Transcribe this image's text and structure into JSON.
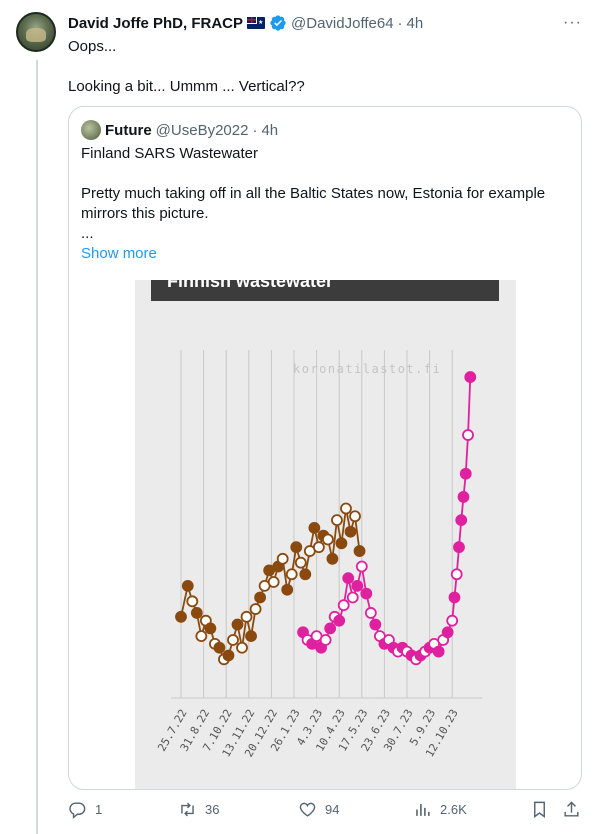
{
  "tweet": {
    "author_name": "David Joffe PhD, FRACP",
    "handle": "@DavidJoffe64",
    "separator": "·",
    "time": "4h",
    "line1": "Oops...",
    "line2": "Looking a bit... Ummm ... Vertical??"
  },
  "quote": {
    "author_name": "Future",
    "handle": "@UseBy2022",
    "separator": "·",
    "time": "4h",
    "line1": "Finland SARS Wastewater",
    "line2": "Pretty much taking off in all the Baltic States now, Estonia for example mirrors this picture.",
    "line3": "...",
    "show_more": "Show more"
  },
  "chart_data": {
    "type": "scatter",
    "title": "Finnish wastewater",
    "watermark": "koronatilastot.fi",
    "categories": [
      "25.7.22",
      "31.8.22",
      "7.10.22",
      "13.11.22",
      "20.12.22",
      "26.1.23",
      "4.3.23",
      "10.4.23",
      "17.5.23",
      "23.6.23",
      "30.7.23",
      "5.9.23",
      "12.10.23"
    ],
    "series": [
      {
        "color": "#8a4a0f",
        "x": [
          0.0,
          0.3,
          0.5,
          0.7,
          0.9,
          1.1,
          1.3,
          1.5,
          1.7,
          1.9,
          2.1,
          2.3,
          2.5,
          2.7,
          2.9,
          3.1,
          3.3,
          3.5,
          3.7,
          3.9,
          4.1,
          4.3,
          4.5,
          4.7,
          4.9,
          5.1,
          5.3,
          5.5,
          5.7,
          5.9,
          6.1,
          6.3,
          6.5,
          6.7,
          6.9,
          7.1,
          7.3,
          7.5,
          7.7,
          7.9
        ],
        "y": [
          2.1,
          2.9,
          2.5,
          2.2,
          1.6,
          2.0,
          1.8,
          1.4,
          1.3,
          1.0,
          1.1,
          1.5,
          1.9,
          1.3,
          2.1,
          1.6,
          2.3,
          2.6,
          2.9,
          3.3,
          3.0,
          3.4,
          3.6,
          2.8,
          3.2,
          3.9,
          3.5,
          3.2,
          3.8,
          4.4,
          3.9,
          4.2,
          4.1,
          3.6,
          4.6,
          4.0,
          4.9,
          4.3,
          4.7,
          3.8
        ],
        "filled": [
          true,
          true,
          false,
          true,
          false,
          false,
          true,
          false,
          true,
          false,
          true,
          false,
          true,
          false,
          false,
          true,
          false,
          true,
          false,
          true,
          false,
          true,
          false,
          true,
          false,
          true,
          false,
          true,
          false,
          true,
          false,
          true,
          false,
          true,
          false,
          true,
          false,
          true,
          false,
          true
        ]
      },
      {
        "color": "#e0219f",
        "x": [
          5.4,
          5.6,
          5.8,
          6.0,
          6.2,
          6.4,
          6.6,
          6.8,
          7.0,
          7.2,
          7.4,
          7.6,
          7.8,
          8.0,
          8.2,
          8.4,
          8.6,
          8.8,
          9.0,
          9.2,
          9.4,
          9.6,
          9.8,
          10.0,
          10.2,
          10.4,
          10.6,
          10.8,
          11.0,
          11.2,
          11.4,
          11.6,
          11.8,
          12.0,
          12.1,
          12.2,
          12.3,
          12.4,
          12.5,
          12.6,
          12.7,
          12.8
        ],
        "y": [
          1.7,
          1.5,
          1.4,
          1.6,
          1.3,
          1.5,
          1.8,
          2.1,
          2.0,
          2.4,
          3.1,
          2.6,
          2.9,
          3.4,
          2.7,
          2.2,
          1.9,
          1.6,
          1.4,
          1.5,
          1.3,
          1.2,
          1.3,
          1.2,
          1.1,
          1.0,
          1.1,
          1.2,
          1.3,
          1.4,
          1.2,
          1.5,
          1.7,
          2.0,
          2.6,
          3.2,
          3.9,
          4.6,
          5.2,
          5.8,
          6.8,
          8.3
        ],
        "filled": [
          true,
          false,
          true,
          false,
          true,
          false,
          true,
          false,
          true,
          false,
          true,
          false,
          true,
          false,
          true,
          false,
          true,
          false,
          true,
          false,
          true,
          false,
          true,
          false,
          true,
          false,
          true,
          false,
          true,
          false,
          true,
          false,
          true,
          false,
          true,
          false,
          true,
          true,
          true,
          true,
          false,
          true
        ]
      }
    ],
    "ylim": [
      0,
      9
    ],
    "grid": true
  },
  "actions": {
    "replies": "1",
    "retweets": "36",
    "likes": "94",
    "views": "2.6K"
  },
  "colors": {
    "link": "#1d9bf0",
    "muted": "#536471",
    "verified": "#1d9bf0"
  }
}
